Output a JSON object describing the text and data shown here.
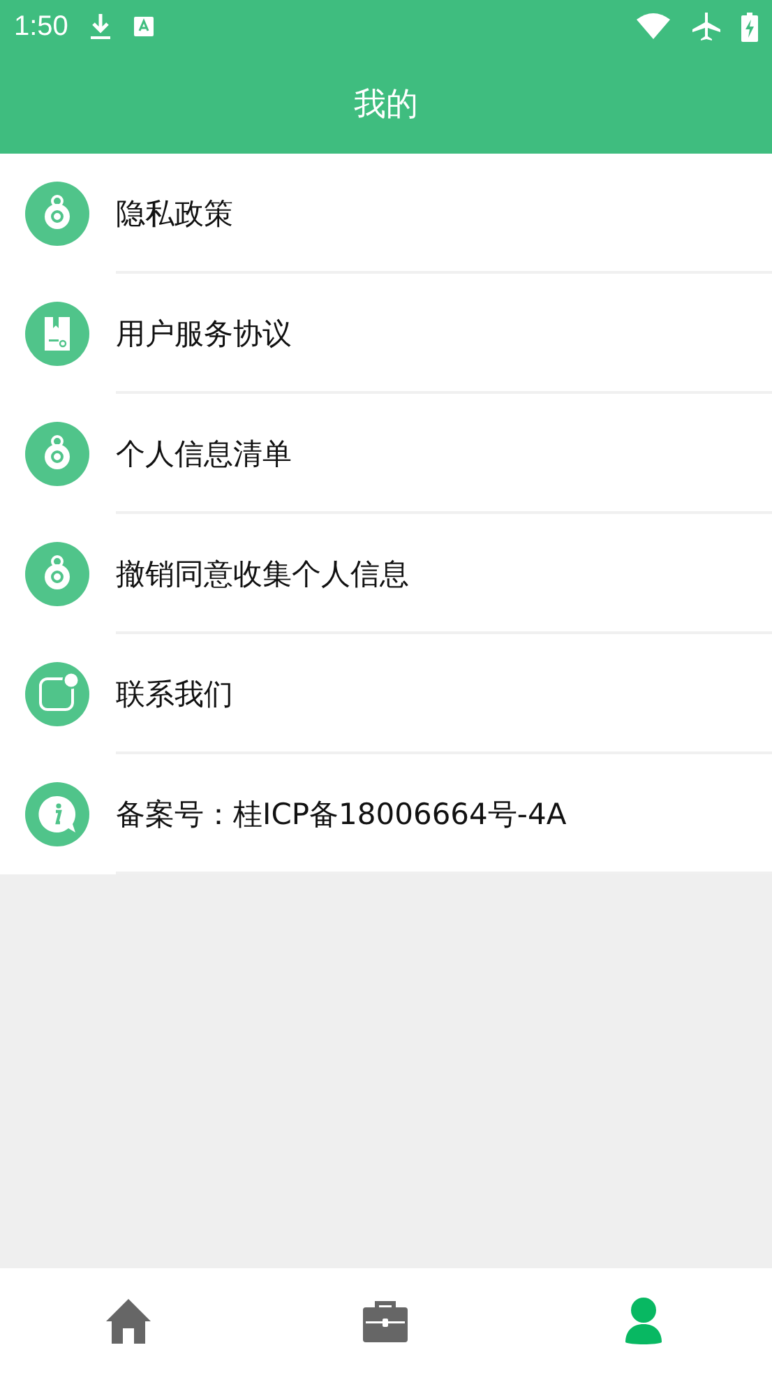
{
  "status_bar": {
    "time": "1:50"
  },
  "header": {
    "title": "我的"
  },
  "menu": [
    {
      "kind": "lock",
      "label": "隐私政策"
    },
    {
      "kind": "doc",
      "label": "用户服务协议"
    },
    {
      "kind": "lock",
      "label": "个人信息清单"
    },
    {
      "kind": "lock",
      "label": "撤销同意收集个人信息"
    },
    {
      "kind": "contact",
      "label": "联系我们"
    },
    {
      "kind": "info",
      "label": "备案号：桂ICP备18006664号-4A"
    }
  ],
  "tabs": [
    {
      "kind": "home",
      "selected": false
    },
    {
      "kind": "briefcase",
      "selected": false
    },
    {
      "kind": "person",
      "selected": true
    }
  ]
}
